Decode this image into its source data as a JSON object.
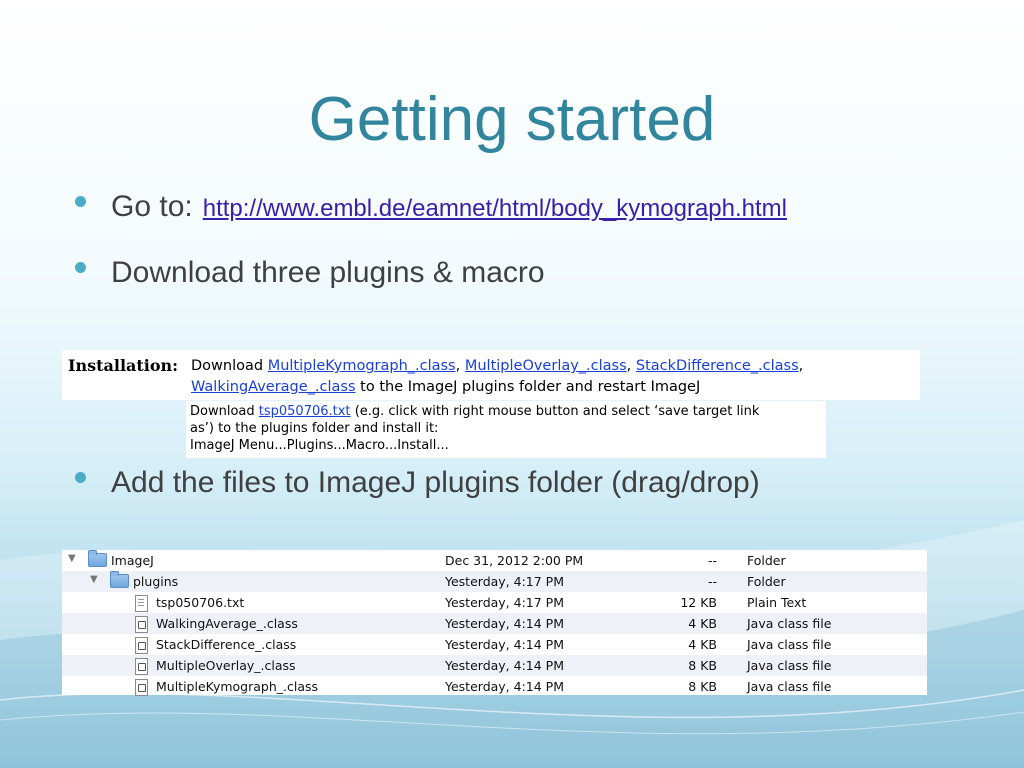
{
  "slide": {
    "title": "Getting started",
    "bullets": [
      {
        "prefix": "Go to:",
        "link": "http://www.embl.de/eamnet/html/body_kymograph.html"
      },
      {
        "text": "Download three plugins & macro"
      },
      {
        "text": "Add the files to ImageJ plugins folder (drag/drop)"
      }
    ]
  },
  "installation": {
    "label": "Installation:",
    "download_word": "Download",
    "plugins": [
      "MultipleKymograph_.class",
      "MultipleOverlay_.class",
      "StackDifference_.class",
      "WalkingAverage_.class"
    ],
    "sep1": ",",
    "sep2": ",",
    "sep3": ",",
    "suffix": "to the ImageJ plugins folder and restart ImageJ"
  },
  "macro": {
    "download_word": "Download",
    "file": "tsp050706.txt",
    "line1_rest": "(e.g. click with right mouse button and select ‘save target link",
    "line2": "as’) to the plugins folder and install it:",
    "line3": "ImageJ Menu...Plugins...Macro...Install..."
  },
  "finder": {
    "rows": [
      {
        "name": "ImageJ",
        "date": "Dec 31, 2012 2:00 PM",
        "size": "--",
        "kind": "Folder"
      },
      {
        "name": "plugins",
        "date": "Yesterday, 4:17 PM",
        "size": "--",
        "kind": "Folder"
      },
      {
        "name": "tsp050706.txt",
        "date": "Yesterday, 4:17 PM",
        "size": "12 KB",
        "kind": "Plain Text"
      },
      {
        "name": "WalkingAverage_.class",
        "date": "Yesterday, 4:14 PM",
        "size": "4 KB",
        "kind": "Java class file"
      },
      {
        "name": "StackDifference_.class",
        "date": "Yesterday, 4:14 PM",
        "size": "4 KB",
        "kind": "Java class file"
      },
      {
        "name": "MultipleOverlay_.class",
        "date": "Yesterday, 4:14 PM",
        "size": "8 KB",
        "kind": "Java class file"
      },
      {
        "name": "MultipleKymograph_.class",
        "date": "Yesterday, 4:14 PM",
        "size": "8 KB",
        "kind": "Java class file"
      }
    ]
  },
  "colors": {
    "title": "#31859c",
    "bullet_dot": "#4bacc6",
    "link": "#3b1ea8",
    "plugin_link": "#1a3fd6",
    "row_alt": "#eef2f8"
  }
}
